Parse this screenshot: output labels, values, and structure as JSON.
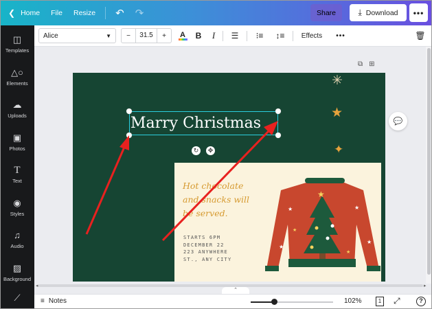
{
  "topbar": {
    "home_label": "Home",
    "file_label": "File",
    "resize_label": "Resize",
    "share_label": "Share",
    "download_label": "Download"
  },
  "sidebar": {
    "items": [
      {
        "label": "Templates",
        "icon": "templates-icon"
      },
      {
        "label": "Elements",
        "icon": "elements-icon"
      },
      {
        "label": "Uploads",
        "icon": "uploads-icon"
      },
      {
        "label": "Photos",
        "icon": "photos-icon"
      },
      {
        "label": "Text",
        "icon": "text-icon"
      },
      {
        "label": "Styles",
        "icon": "styles-icon"
      },
      {
        "label": "Audio",
        "icon": "audio-icon"
      },
      {
        "label": "Background",
        "icon": "background-icon"
      }
    ]
  },
  "toolbar": {
    "font_name": "Alice",
    "font_size": "31.5",
    "minus_label": "−",
    "plus_label": "+",
    "bold_label": "B",
    "italic_label": "I",
    "color_label": "A",
    "effects_label": "Effects"
  },
  "design": {
    "title": "Marry Christmas",
    "hot_text": "Hot chocolate and snacks will be served.",
    "info_lines": [
      "STARTS 6PM",
      "DECEMBER 22",
      "223 ANYWHERE",
      "ST., ANY CITY"
    ],
    "background_color": "#164533",
    "card_color": "#fbf3dd",
    "accent_color": "#d69a30"
  },
  "bottombar": {
    "notes_label": "Notes",
    "zoom": "102%",
    "zoom_fraction": 0.28,
    "page_count": "1",
    "help_label": "?"
  },
  "colors": {
    "topbar_gradient_start": "#18b4c8",
    "topbar_gradient_end": "#6a4fe0",
    "sidebar_bg": "#18191b",
    "selection": "#2bd0e0",
    "annotation_arrow": "#e8211f"
  }
}
